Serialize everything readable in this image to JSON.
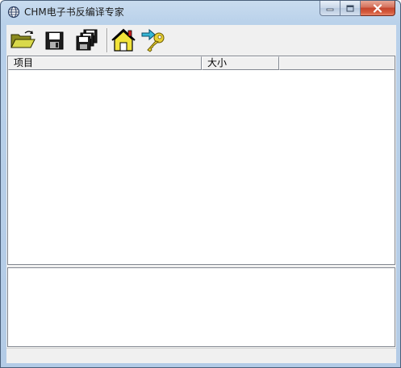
{
  "window": {
    "title": "CHM电子书反编译专家",
    "icon": "globe-icon",
    "caption_buttons": [
      "minimize-icon",
      "maximize-icon",
      "close-icon"
    ]
  },
  "toolbar": {
    "buttons": [
      {
        "name": "open-folder",
        "icon": "open-folder-icon"
      },
      {
        "name": "save",
        "icon": "floppy-disk-icon"
      },
      {
        "name": "save-all",
        "icon": "multiple-floppy-icon"
      },
      {
        "name": "home",
        "icon": "house-icon"
      },
      {
        "name": "exit",
        "icon": "key-arrow-icon"
      }
    ]
  },
  "list": {
    "columns": [
      {
        "label": "项目"
      },
      {
        "label": "大小"
      },
      {
        "label": ""
      }
    ],
    "rows": []
  },
  "details": {
    "text": ""
  },
  "statusbar": {
    "text": ""
  },
  "colors": {
    "title_bar": "#b9d1ea",
    "close_button": "#c4452e",
    "panel_bg": "#ffffff",
    "chrome_bg": "#f0f0f0"
  }
}
